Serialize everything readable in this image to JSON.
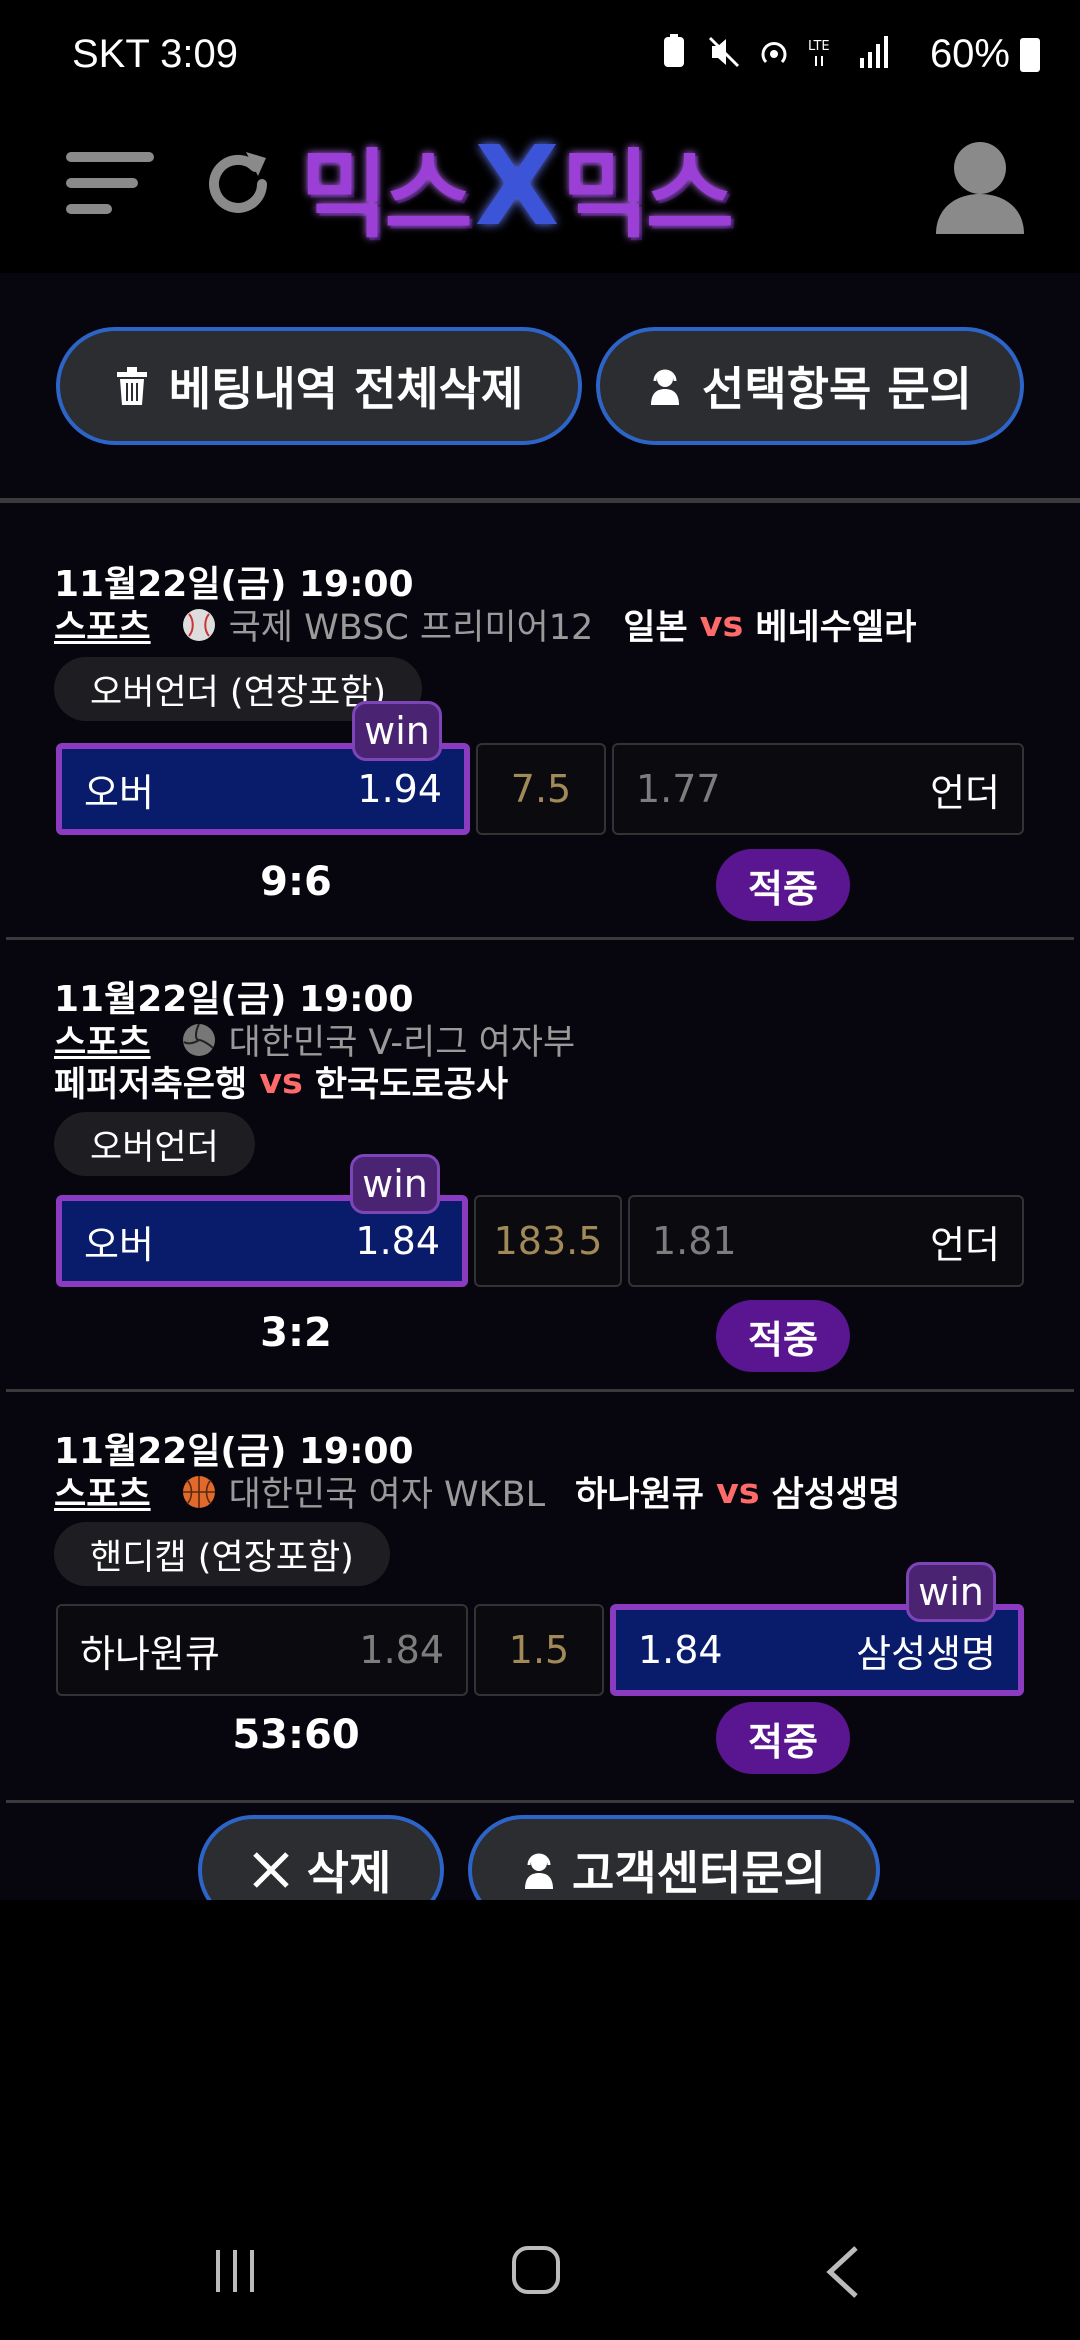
{
  "status_bar": {
    "carrier_time": "SKT 3:09",
    "battery": "60%"
  },
  "header": {
    "logo_left": "믹스",
    "logo_x": "X",
    "logo_right": "믹스"
  },
  "actions": {
    "delete_all_label": "베팅내역 전체삭제",
    "inquiry_label": "선택항목 문의"
  },
  "bets": [
    {
      "date": "11월22일(금) 19:00",
      "category": "스포츠",
      "sport_icon": "baseball-icon",
      "league": "국제 WBSC 프리미어12",
      "home": "일본",
      "vs": "vs",
      "away": "베네수엘라",
      "market": "오버언더 (연장포함)",
      "left_label": "오버",
      "left_odds": "1.94",
      "line": "7.5",
      "right_odds": "1.77",
      "right_label": "언더",
      "win_tag": "win",
      "selected": "left",
      "score": "9:6",
      "result": "적중"
    },
    {
      "date": "11월22일(금) 19:00",
      "category": "스포츠",
      "sport_icon": "volleyball-icon",
      "league": "대한민국 V-리그 여자부",
      "home": "페퍼저축은행",
      "vs": "vs",
      "away": "한국도로공사",
      "market": "오버언더",
      "left_label": "오버",
      "left_odds": "1.84",
      "line": "183.5",
      "right_odds": "1.81",
      "right_label": "언더",
      "win_tag": "win",
      "selected": "left",
      "score": "3:2",
      "result": "적중"
    },
    {
      "date": "11월22일(금) 19:00",
      "category": "스포츠",
      "sport_icon": "basketball-icon",
      "league": "대한민국 여자 WKBL",
      "home": "하나원큐",
      "vs": "vs",
      "away": "삼성생명",
      "market": "핸디캡 (연장포함)",
      "left_label": "하나원큐",
      "left_odds": "1.84",
      "line": "1.5",
      "right_odds": "1.84",
      "right_label": "삼성생명",
      "win_tag": "win",
      "selected": "right",
      "score": "53:60",
      "result": "적중"
    }
  ],
  "bottom_actions": {
    "delete_label": "삭제",
    "cs_label": "고객센터문의"
  },
  "colors": {
    "accent_purple": "#8b3bbf",
    "selected_bg": "#081c6b",
    "button_border": "#2c64c8",
    "vs_red": "#ff6b6b"
  }
}
